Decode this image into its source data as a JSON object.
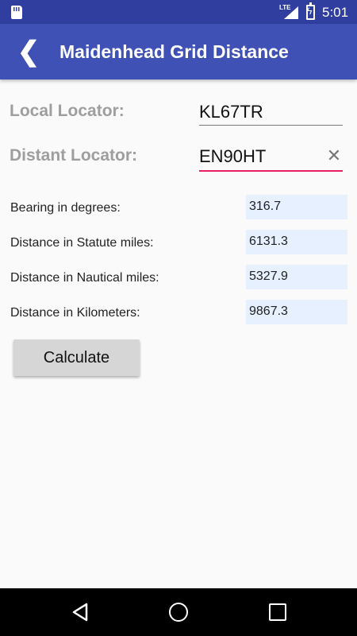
{
  "status_bar": {
    "network_type": "LTE",
    "time": "5:01",
    "icons": [
      "sd-card-icon",
      "signal-icon",
      "battery-charging-icon"
    ]
  },
  "app_bar": {
    "title": "Maidenhead Grid Distance",
    "back_icon": "chevron-left-icon"
  },
  "form": {
    "local_label": "Local Locator:",
    "local_value": "KL67TR",
    "distant_label": "Distant Locator:",
    "distant_value": "EN90HT",
    "clear_glyph": "✕"
  },
  "results": [
    {
      "label": "Bearing in degrees:",
      "value": "316.7"
    },
    {
      "label": "Distance in Statute miles:",
      "value": "6131.3"
    },
    {
      "label": "Distance in Nautical miles:",
      "value": "5327.9"
    },
    {
      "label": "Distance in Kilometers:",
      "value": "9867.3"
    }
  ],
  "calculate_label": "Calculate",
  "nav_bar": {
    "icons": [
      "back-triangle-icon",
      "home-circle-icon",
      "recents-square-icon"
    ]
  },
  "colors": {
    "primary": "#3f51b5",
    "primary_dark": "#303f9f",
    "accent": "#e91e63",
    "result_bg": "#e6f0ff",
    "label_gray": "#9e9e9e"
  }
}
